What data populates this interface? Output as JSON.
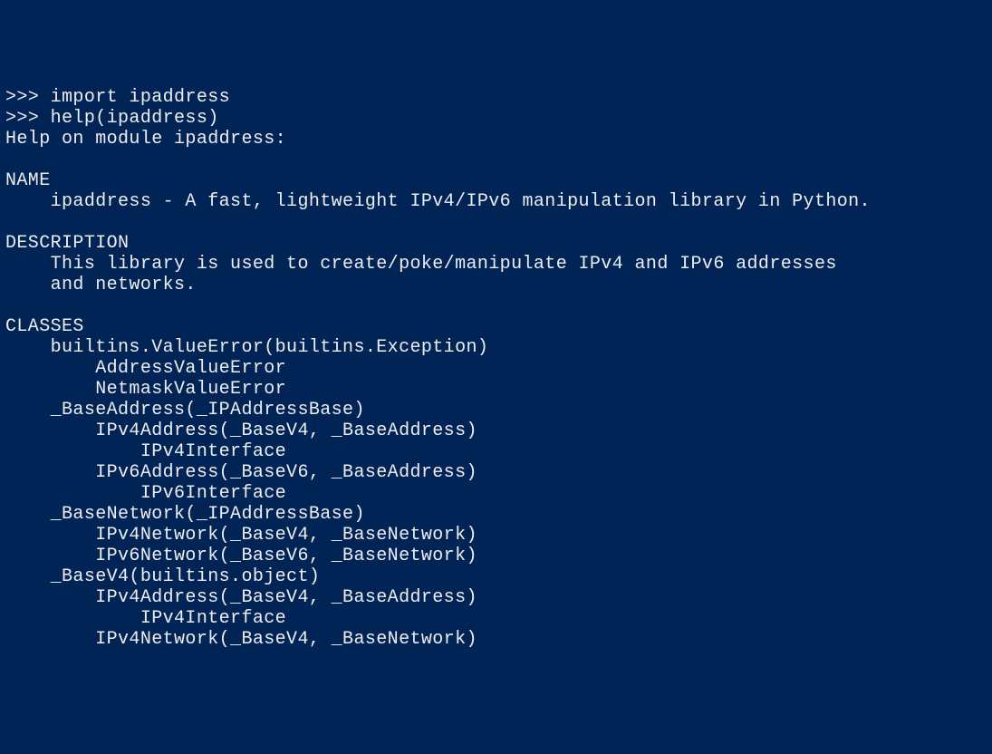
{
  "terminal": {
    "lines": [
      {
        "prefix": ">>> ",
        "text": "import ipaddress",
        "cls": "input-cmd"
      },
      {
        "prefix": ">>> ",
        "text": "help(ipaddress)",
        "cls": "input-cmd"
      },
      {
        "prefix": "",
        "text": "Help on module ipaddress:",
        "cls": "output"
      },
      {
        "prefix": "",
        "text": "",
        "cls": "output"
      },
      {
        "prefix": "",
        "text": "NAME",
        "cls": "output"
      },
      {
        "prefix": "",
        "text": "    ipaddress - A fast, lightweight IPv4/IPv6 manipulation library in Python.",
        "cls": "output"
      },
      {
        "prefix": "",
        "text": "",
        "cls": "output"
      },
      {
        "prefix": "",
        "text": "DESCRIPTION",
        "cls": "output"
      },
      {
        "prefix": "",
        "text": "    This library is used to create/poke/manipulate IPv4 and IPv6 addresses",
        "cls": "output"
      },
      {
        "prefix": "",
        "text": "    and networks.",
        "cls": "output"
      },
      {
        "prefix": "",
        "text": "",
        "cls": "output"
      },
      {
        "prefix": "",
        "text": "CLASSES",
        "cls": "output"
      },
      {
        "prefix": "",
        "text": "    builtins.ValueError(builtins.Exception)",
        "cls": "output"
      },
      {
        "prefix": "",
        "text": "        AddressValueError",
        "cls": "output"
      },
      {
        "prefix": "",
        "text": "        NetmaskValueError",
        "cls": "output"
      },
      {
        "prefix": "",
        "text": "    _BaseAddress(_IPAddressBase)",
        "cls": "output"
      },
      {
        "prefix": "",
        "text": "        IPv4Address(_BaseV4, _BaseAddress)",
        "cls": "output"
      },
      {
        "prefix": "",
        "text": "            IPv4Interface",
        "cls": "output"
      },
      {
        "prefix": "",
        "text": "        IPv6Address(_BaseV6, _BaseAddress)",
        "cls": "output"
      },
      {
        "prefix": "",
        "text": "            IPv6Interface",
        "cls": "output"
      },
      {
        "prefix": "",
        "text": "    _BaseNetwork(_IPAddressBase)",
        "cls": "output"
      },
      {
        "prefix": "",
        "text": "        IPv4Network(_BaseV4, _BaseNetwork)",
        "cls": "output"
      },
      {
        "prefix": "",
        "text": "        IPv6Network(_BaseV6, _BaseNetwork)",
        "cls": "output"
      },
      {
        "prefix": "",
        "text": "    _BaseV4(builtins.object)",
        "cls": "output"
      },
      {
        "prefix": "",
        "text": "        IPv4Address(_BaseV4, _BaseAddress)",
        "cls": "output"
      },
      {
        "prefix": "",
        "text": "            IPv4Interface",
        "cls": "output"
      },
      {
        "prefix": "",
        "text": "        IPv4Network(_BaseV4, _BaseNetwork)",
        "cls": "output"
      }
    ]
  }
}
